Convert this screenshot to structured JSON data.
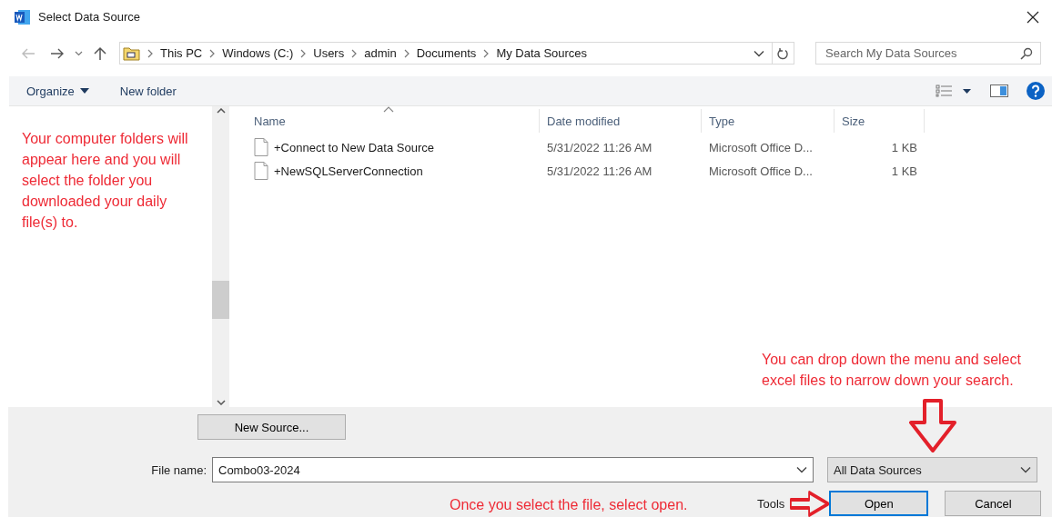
{
  "window": {
    "title": "Select Data Source"
  },
  "navigation": {
    "path": [
      "This PC",
      "Windows (C:)",
      "Users",
      "admin",
      "Documents",
      "My Data Sources"
    ],
    "search": {
      "placeholder": "Search My Data Sources"
    }
  },
  "toolbar": {
    "buttons": [
      "Organize",
      "New folder"
    ]
  },
  "table": {
    "columns": [
      "Name",
      "Date modified",
      "Type",
      "Size"
    ],
    "rows": [
      {
        "name": "+Connect to New Data Source",
        "date": "5/31/2022 11:26 AM",
        "type": "Microsoft Office D...",
        "size": "1 KB"
      },
      {
        "name": "+NewSQLServerConnection",
        "date": "5/31/2022 11:26 AM",
        "type": "Microsoft Office D...",
        "size": "1 KB"
      }
    ]
  },
  "new_source_button": "New Source...",
  "file_name": {
    "label": "File name:",
    "value": "Combo03-2024"
  },
  "file_type": {
    "value": "All Data Sources"
  },
  "tools_label": "Tools",
  "buttons": [
    {
      "label": "Open",
      "selected": true
    },
    {
      "label": "Cancel",
      "selected": false
    }
  ],
  "annotations": [
    {
      "kind": "folders",
      "text": "Your computer folders will appear here and you will select the folder you downloaded your daily file(s) to."
    },
    {
      "kind": "filter",
      "text": "You can drop down the menu and select excel files to narrow down your search."
    },
    {
      "kind": "open",
      "text": "Once you select the file, select open."
    }
  ]
}
